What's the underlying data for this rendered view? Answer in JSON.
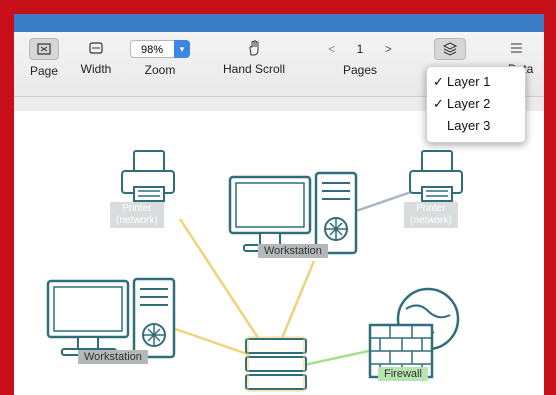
{
  "toolbar": {
    "page_label": "Page",
    "width_label": "Width",
    "zoom_value": "98%",
    "zoom_label": "Zoom",
    "hand_scroll_label": "Hand Scroll",
    "prev_page_glyph": "<",
    "page_number": "1",
    "next_page_glyph": ">",
    "pages_label": "Pages",
    "layers_icon": "layers-icon",
    "data_label_partial": "e Data"
  },
  "layers_menu": {
    "items": [
      {
        "label": "Layer 1",
        "checked": true
      },
      {
        "label": "Layer 2",
        "checked": true
      },
      {
        "label": "Layer 3",
        "checked": false
      }
    ],
    "check_glyph": "✓"
  },
  "diagram": {
    "printer_left": {
      "line1": "Printer",
      "line2": "(network)"
    },
    "printer_right": {
      "line1": "Printer",
      "line2": "(network)"
    },
    "workstation_top": "Workstation",
    "workstation_left": "Workstation",
    "firewall": "Firewall"
  },
  "colors": {
    "frame": "#c8101a",
    "titlebar": "#3a7cc6",
    "line_yellow": "#f0d27a",
    "line_green": "#a8e08f",
    "line_gray": "#a9b7c2",
    "device": "#2f6e7a"
  }
}
